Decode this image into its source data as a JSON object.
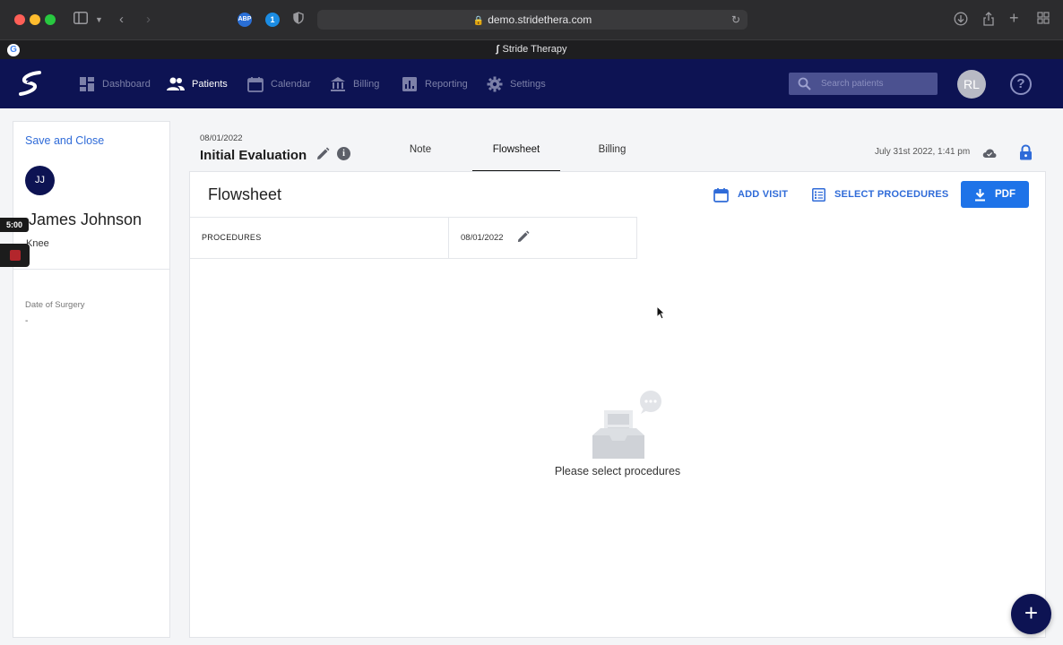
{
  "browser": {
    "url": "demo.stridethera.com",
    "tab_title": "Stride Therapy",
    "favicon_letter": "G",
    "ext_1": "ABP",
    "ext_2": "1"
  },
  "nav": {
    "items": [
      {
        "label": "Dashboard",
        "icon": "dashboard-icon"
      },
      {
        "label": "Patients",
        "icon": "patients-icon",
        "active": true
      },
      {
        "label": "Calendar",
        "icon": "calendar-icon"
      },
      {
        "label": "Billing",
        "icon": "bank-icon"
      },
      {
        "label": "Reporting",
        "icon": "chart-icon"
      },
      {
        "label": "Settings",
        "icon": "gear-icon"
      }
    ],
    "search_placeholder": "Search patients",
    "user_initials": "RL",
    "help": "?"
  },
  "patient": {
    "save_close": "Save and Close",
    "initials": "JJ",
    "name": "James Johnson",
    "body_part": "Knee",
    "date_of_surgery_label": "Date of Surgery",
    "date_of_surgery_value": "-"
  },
  "recorder": {
    "timer": "5:00"
  },
  "visit": {
    "date": "08/01/2022",
    "title": "Initial Evaluation",
    "info": "i",
    "tabs": [
      "Note",
      "Flowsheet",
      "Billing"
    ],
    "active_tab": "Flowsheet",
    "saved_at": "July 31st 2022, 1:41 pm"
  },
  "flowsheet": {
    "title": "Flowsheet",
    "add_visit": "ADD VISIT",
    "select_procedures": "SELECT PROCEDURES",
    "pdf": "PDF",
    "procedures_header": "PROCEDURES",
    "column_date": "08/01/2022",
    "empty_message": "Please select procedures"
  },
  "fab": "+",
  "colors": {
    "nav_bg": "#0d1353",
    "accent": "#2f6bd8",
    "primary_button": "#1e73e8"
  }
}
